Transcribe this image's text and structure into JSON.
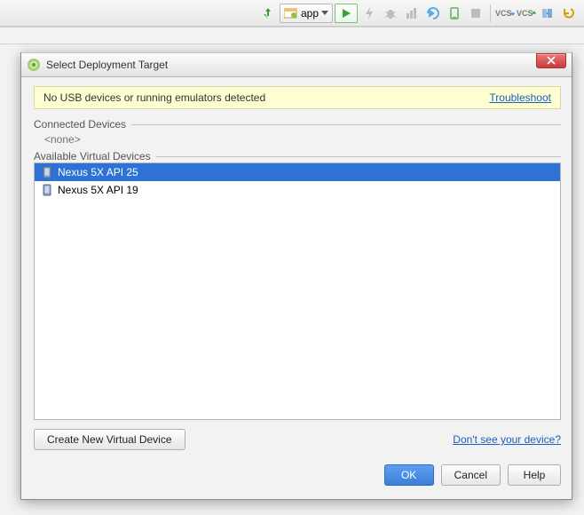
{
  "toolbar": {
    "module_label": "app",
    "icons": {
      "sync": "sync-icon",
      "run": "run-icon",
      "apply": "apply-changes-icon",
      "debug": "debug-icon",
      "profile": "profile-icon",
      "coverage": "coverage-icon",
      "attach": "attach-icon",
      "stop": "stop-icon",
      "vcs_update": "VCS",
      "vcs_commit": "VCS",
      "push": "push-icon",
      "revert": "revert-icon"
    }
  },
  "dialog": {
    "title": "Select Deployment Target",
    "warning": "No USB devices or running emulators detected",
    "troubleshoot": "Troubleshoot",
    "connected_heading": "Connected Devices",
    "connected_none": "<none>",
    "available_heading": "Available Virtual Devices",
    "virtual_devices": [
      {
        "name": "Nexus 5X API 25",
        "selected": true
      },
      {
        "name": "Nexus 5X API 19",
        "selected": false
      }
    ],
    "create_new": "Create New Virtual Device",
    "dont_see": "Don't see your device?",
    "ok": "OK",
    "cancel": "Cancel",
    "help": "Help"
  }
}
